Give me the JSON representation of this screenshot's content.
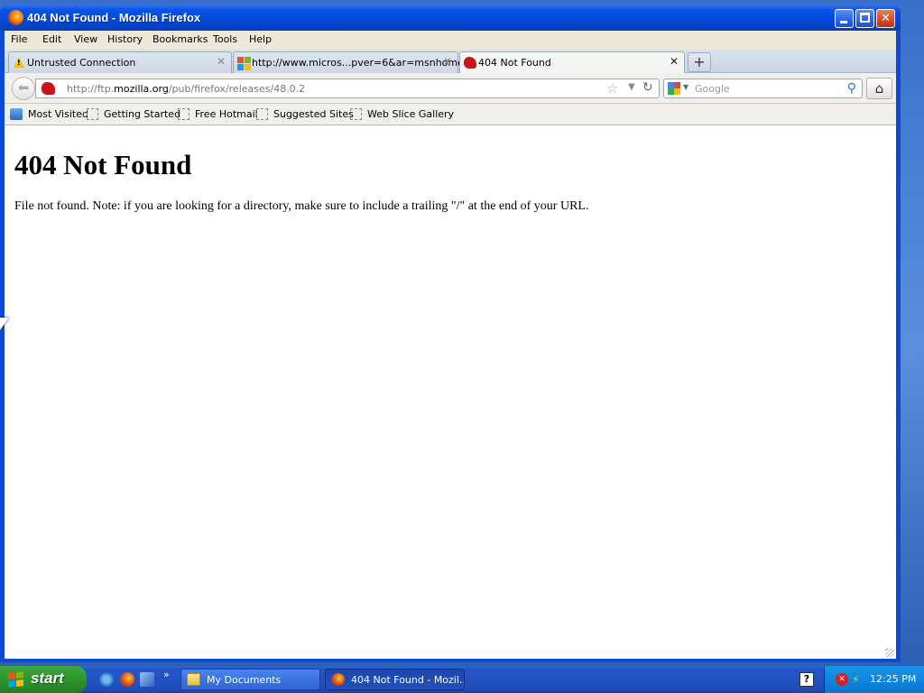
{
  "window": {
    "title": "404 Not Found - Mozilla Firefox",
    "buttons": {
      "minimize": "",
      "maximize": "",
      "close": "✕"
    }
  },
  "menubar": {
    "items": [
      "File",
      "Edit",
      "View",
      "History",
      "Bookmarks",
      "Tools",
      "Help"
    ]
  },
  "tabs": [
    {
      "label": "Untrusted Connection",
      "icon": "warning-icon",
      "active": false
    },
    {
      "label": "http://www.micros...pver=6&ar=msnhome",
      "icon": "microsoft-icon",
      "active": false
    },
    {
      "label": "404 Not Found",
      "icon": "mozilla-dino-icon",
      "active": true
    }
  ],
  "newtab_label": "+",
  "navbar": {
    "url_prefix": "http://ftp.",
    "url_domain": "mozilla.org",
    "url_path": "/pub/firefox/releases/48.0.2",
    "search_placeholder": "Google",
    "home_icon": "home-icon"
  },
  "bookmarks": [
    "Most Visited",
    "Getting Started",
    "Free Hotmail",
    "Suggested Sites",
    "Web Slice Gallery"
  ],
  "page": {
    "heading": "404 Not Found",
    "body": "File not found. Note: if you are looking for a directory, make sure to include a trailing \"/\" at the end of your URL."
  },
  "taskbar": {
    "start_label": "start",
    "quicklaunch_more": "»",
    "tasks": [
      {
        "label": "My Documents",
        "active": false
      },
      {
        "label": "404 Not Found - Mozil...",
        "active": true
      }
    ],
    "help_label": "?",
    "clock": "12:25 PM"
  },
  "colors": {
    "titlebar": "#0349d8",
    "taskbar": "#2352c2",
    "start_button": "#2f9a2f",
    "tray": "#0f86df"
  }
}
